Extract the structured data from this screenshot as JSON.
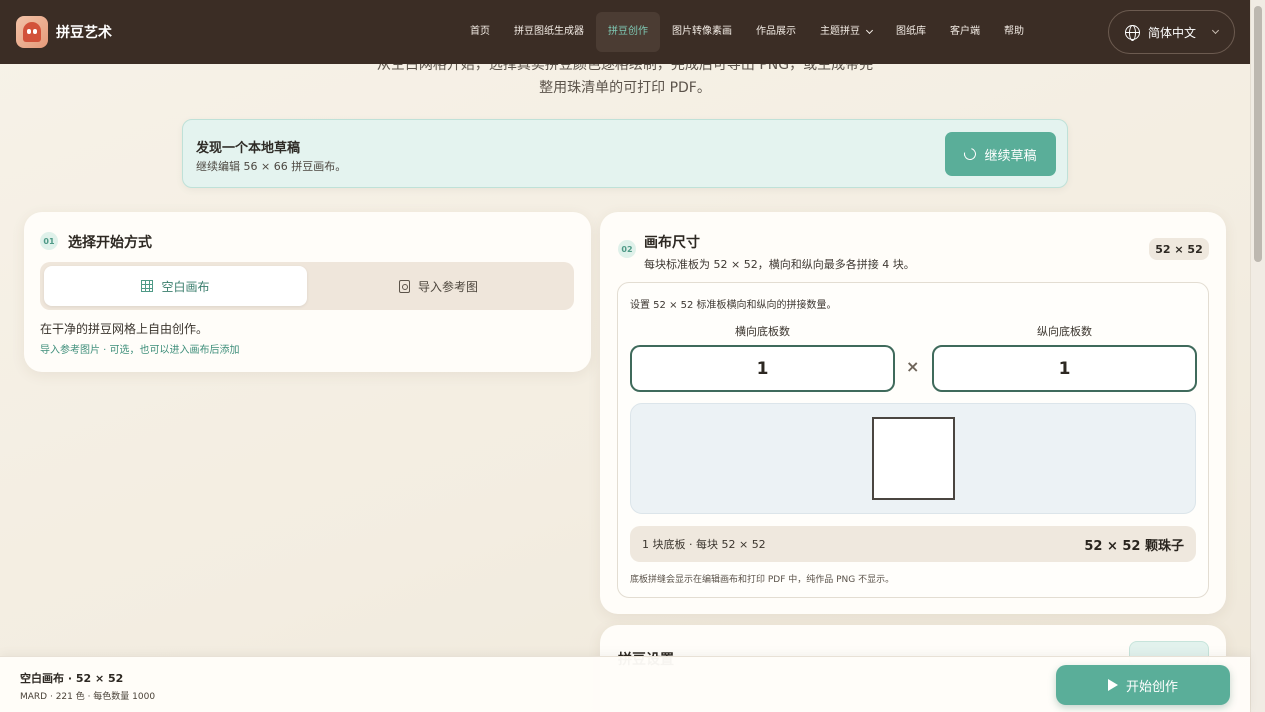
{
  "nav": {
    "brand": "拼豆艺术",
    "items": [
      {
        "label": "首页"
      },
      {
        "label": "拼豆图纸生成器"
      },
      {
        "label": "拼豆创作"
      },
      {
        "label": "图片转像素画"
      },
      {
        "label": "作品展示"
      },
      {
        "label": "主题拼豆"
      },
      {
        "label": "图纸库"
      },
      {
        "label": "客户端"
      },
      {
        "label": "帮助"
      }
    ],
    "active_item": "拼豆创作",
    "language": "简体中文"
  },
  "intro": {
    "line1": "从空白网格开始，选择真实拼豆颜色逐格绘制，完成后可导出 PNG，或生成带完",
    "line2": "整用珠清单的可打印 PDF。"
  },
  "draft": {
    "title": "发现一个本地草稿",
    "subtitle": "继续编辑 56 × 66 拼豆画布。",
    "button": "继续草稿"
  },
  "start_mode": {
    "step": "01",
    "title": "选择开始方式",
    "options": [
      {
        "label": "空白画布",
        "icon": "grid-icon",
        "selected": true
      },
      {
        "label": "导入参考图",
        "icon": "image-file-icon",
        "selected": false
      }
    ],
    "description": "在干净的拼豆网格上自由创作。",
    "hint": "导入参考图片 · 可选，也可以进入画布后添加"
  },
  "canvas_size": {
    "step": "02",
    "title": "画布尺寸",
    "subtitle": "每块标准板为 52 × 52，横向和纵向最多各拼接 4 块。",
    "badge": "52 × 52",
    "note": "设置 52 × 52 标准板横向和纵向的拼接数量。",
    "horizontal_label": "横向底板数",
    "horizontal_value": "1",
    "vertical_label": "纵向底板数",
    "vertical_value": "1",
    "multiply_sign": "×",
    "summary_left": "1 块底板 · 每块 52 × 52",
    "summary_right": "52 × 52 颗珠子",
    "footnote": "底板拼缝会显示在编辑画布和打印 PDF 中，纯作品 PNG 不显示。"
  },
  "palette_settings": {
    "title": "拼豆设置"
  },
  "bottom_bar": {
    "title": "空白画布 · 52 × 52",
    "subtitle": "MARD · 221 色 · 每色数量 1000",
    "start_button": "开始创作"
  },
  "colors": {
    "nav_bg": "#3b2d25",
    "accent": "#5aae99",
    "active_nav_text": "#7fc9b4"
  }
}
